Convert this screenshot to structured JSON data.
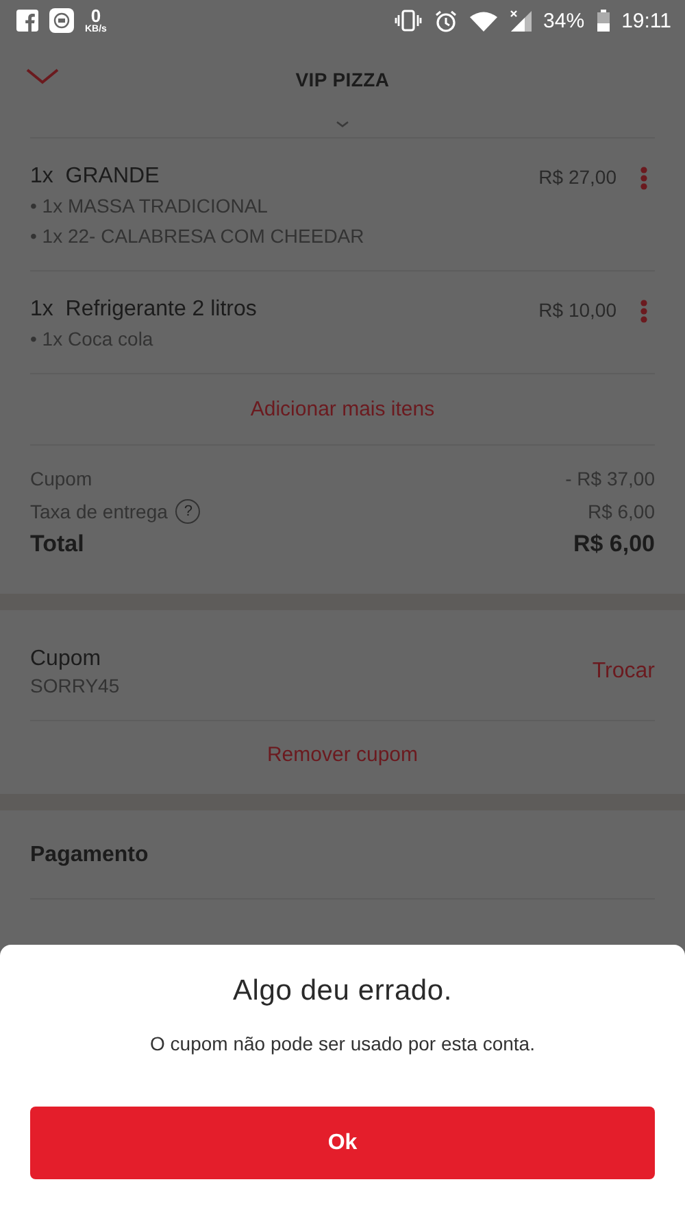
{
  "status_bar": {
    "net_speed": "0",
    "net_unit": "KB/s",
    "battery": "34%",
    "time": "19:11"
  },
  "header": {
    "title": "VIP PIZZA"
  },
  "items": [
    {
      "name": "1x  GRANDE",
      "price": "R$ 27,00",
      "options": [
        "• 1x MASSA TRADICIONAL",
        "• 1x 22- CALABRESA COM CHEEDAR"
      ]
    },
    {
      "name": "1x  Refrigerante 2 litros",
      "price": "R$ 10,00",
      "options": [
        "• 1x Coca cola"
      ]
    }
  ],
  "add_more": "Adicionar mais itens",
  "summary": [
    {
      "kind": "line",
      "label": "Cupom",
      "value": "- R$ 37,00"
    },
    {
      "kind": "info",
      "label": "Taxa de entrega",
      "info": "?",
      "value": "R$ 6,00"
    },
    {
      "kind": "total",
      "label": "Total",
      "value": "R$ 6,00"
    }
  ],
  "coupon": {
    "title": "Cupom",
    "code": "SORRY45",
    "change": "Trocar",
    "remove": "Remover cupom"
  },
  "payment": {
    "title": "Pagamento"
  },
  "dialog": {
    "title": "Algo deu errado.",
    "message": "O cupom não pode ser usado por esta conta.",
    "button": "Ok"
  }
}
